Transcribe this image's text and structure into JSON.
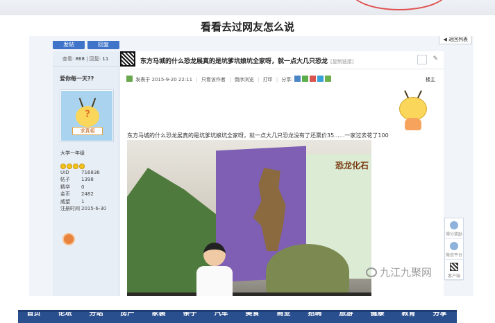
{
  "headline": "看看去过网友怎么说",
  "forum": {
    "buttons": [
      {
        "label": "发帖"
      },
      {
        "label": "回复"
      }
    ],
    "back_label": "◀ 返回列表",
    "stats": {
      "views_label": "查看:",
      "views": "868",
      "sep": "|",
      "replies_label": "回复:",
      "replies": "11"
    },
    "post_title": "东方马城的什么恐龙展真的是坑爹坑娘坑全家呀，就一点大几只恐龙",
    "copy_link": "[复制链接]",
    "post_info": {
      "posted_at": "发表于 2015-9-20 22:11",
      "only_author": "只看该作者",
      "reverse": "倒序浏览",
      "print": "打印",
      "share": "分享:",
      "floor": "楼主"
    },
    "post_text": "东方马城的什么恐龙展真的是坑爹坑娘坑全家呀，就一点大几只恐龙没有了还票价35......一家过去花了100",
    "user": {
      "name": "爱你每一天??",
      "avatar_tag": "求真相",
      "level": "大学一年级",
      "fields": [
        {
          "k": "UID",
          "v": "716836"
        },
        {
          "k": "帖子",
          "v": "1398"
        },
        {
          "k": "精华",
          "v": "0"
        },
        {
          "k": "金币",
          "v": "2482"
        },
        {
          "k": "威望",
          "v": "1"
        },
        {
          "k": "注册时间",
          "v": "2015-6-30"
        }
      ]
    },
    "photo_sign": "恐龙化石",
    "floating": [
      {
        "label": "得分奖励"
      },
      {
        "label": "微信平台"
      },
      {
        "label": "客户端"
      }
    ],
    "colors": {
      "accent": "#3f74c9",
      "nav": "#2a4f8f",
      "sidebar": "#e8eef6"
    }
  },
  "watermark": "九江九聚网",
  "nav": [
    "首页",
    "论坛",
    "分站",
    "房产",
    "家装",
    "亲子",
    "汽车",
    "美食",
    "商业",
    "招聘",
    "旅游",
    "健康",
    "教育",
    "分享"
  ]
}
